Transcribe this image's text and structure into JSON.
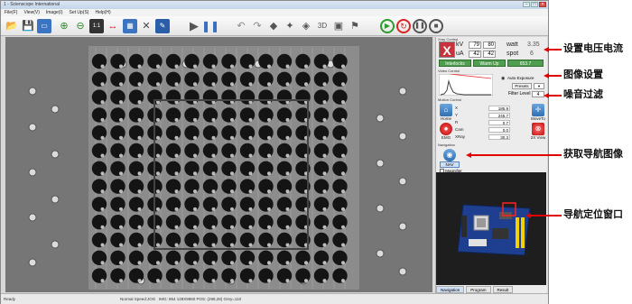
{
  "window": {
    "title": "1 - Scienscope International"
  },
  "menu": [
    "File(F)",
    "View(V)",
    "Image(I)",
    "Set Up(S)",
    "Help(H)"
  ],
  "toolbar": {
    "scale_label": "1:1"
  },
  "xray_panel": {
    "title": "Xray Control",
    "kv_label": "kV",
    "kv_set": "79",
    "kv_actual": "80",
    "ua_label": "uA",
    "ua_set": "42",
    "ua_actual": "42",
    "watt_label": "watt",
    "watt_value": "3.35",
    "spot_label": "spot",
    "spot_value": "6",
    "interlocks": "Interlocks",
    "warmup": "Warm Up",
    "status_value": "653.7"
  },
  "video_panel": {
    "title": "Video Control",
    "auto_exposure": "Auto Exposure",
    "presets": "Presets",
    "filter_level_label": "Filter Level",
    "filter_level_value": "4"
  },
  "motion_panel": {
    "title": "Motion Control",
    "home": "Home",
    "emg": "EMG",
    "move_to": "MoveTo",
    "zx_view": "2X View",
    "rows": [
      {
        "label": "X",
        "value": "185.9"
      },
      {
        "label": "Y",
        "value": "245.7"
      },
      {
        "label": "R",
        "value": "0.7"
      },
      {
        "label": "Cam",
        "value": "0.0"
      },
      {
        "label": "XRay",
        "value": "30.3"
      }
    ]
  },
  "navigation_panel": {
    "title": "Navigation",
    "nav": "NAV",
    "magnifier": "Magnifier"
  },
  "tabs": [
    "Navigation",
    "Program",
    "Result"
  ],
  "statusbar": {
    "ready": "Ready",
    "speed": "Normal Speed:JOG",
    "info": "IMG: 864 128X9960  POS: (298,28) Grey=110"
  },
  "annotations": {
    "voltage_current": "设置电压电流",
    "image_settings": "图像设置",
    "noise_filter": "噪音过滤",
    "nav_image": "获取导航图像",
    "nav_window": "导航定位窗口"
  },
  "colors": {
    "accent_red": "#e00000",
    "button_blue": "#2f6fb2",
    "green": "#4f9d4f"
  }
}
